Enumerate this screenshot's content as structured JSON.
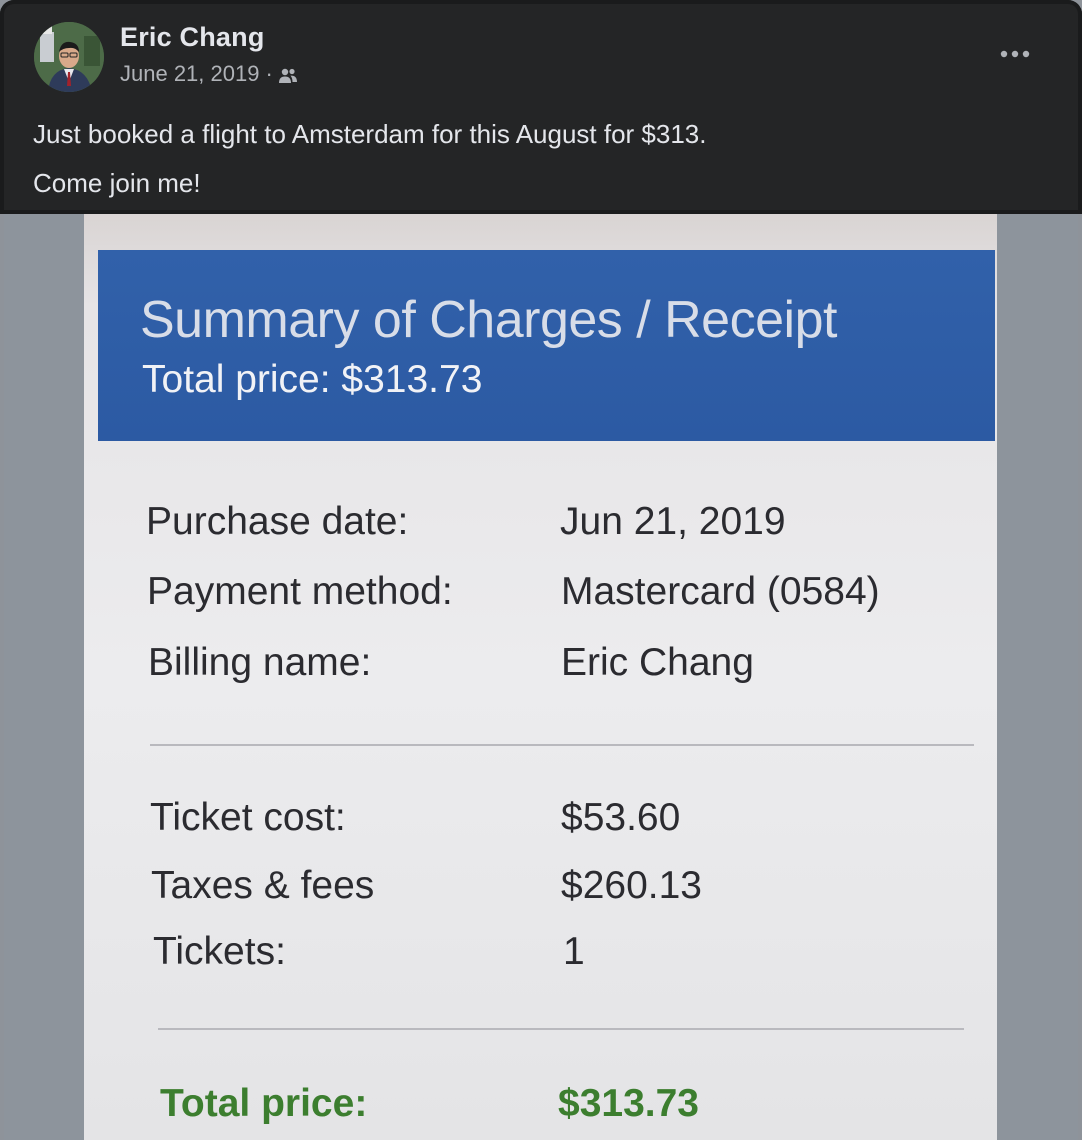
{
  "post": {
    "author": "Eric Chang",
    "date": "June 21, 2019",
    "separator": "·",
    "audience_icon": "friends-icon",
    "more_icon": "more-options-icon",
    "text_lines": [
      "Just booked a flight to Amsterdam for this August for $313.",
      "Come join me!"
    ]
  },
  "receipt": {
    "title": "Summary of Charges / Receipt",
    "banner_total": "Total price: $313.73",
    "details": [
      {
        "label": "Purchase date:",
        "value": "Jun 21, 2019"
      },
      {
        "label": "Payment method:",
        "value": "Mastercard (0584)"
      },
      {
        "label": "Billing name:",
        "value": "Eric Chang"
      }
    ],
    "costs": [
      {
        "label": "Ticket cost:",
        "value": "$53.60"
      },
      {
        "label": "Taxes & fees",
        "value": "$260.13"
      },
      {
        "label": "Tickets:",
        "value": "1"
      }
    ],
    "total_label": "Total price:",
    "total_value": "$313.73"
  },
  "colors": {
    "post_background": "#242526",
    "text_primary": "#e4e6eb",
    "text_secondary": "#b0b3b8",
    "receipt_banner": "#2f5ea8",
    "total_green": "#3c7e2f"
  }
}
